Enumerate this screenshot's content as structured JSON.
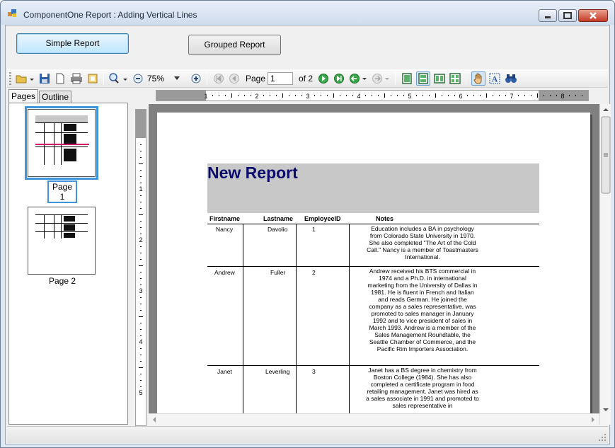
{
  "window": {
    "title": "ComponentOne Report : Adding Vertical Lines",
    "controls": [
      "minimize",
      "maximize",
      "close"
    ]
  },
  "buttons": {
    "simple_report": "Simple Report",
    "grouped_report": "Grouped Report"
  },
  "toolbar": {
    "zoom_value": "75%",
    "page_label": "Page",
    "page_value": "1",
    "of_label": "of 2"
  },
  "tabs": {
    "pages": "Pages",
    "outline": "Outline"
  },
  "thumbnails": [
    {
      "label": "Page 1",
      "selected": true
    },
    {
      "label": "Page 2",
      "selected": false
    }
  ],
  "rulers": {
    "horizontal_ticks": [
      "1",
      "2",
      "3",
      "4",
      "5",
      "6",
      "7",
      "8"
    ],
    "vertical_ticks": [
      "1",
      "2",
      "3",
      "4",
      "5"
    ]
  },
  "report": {
    "title": "New Report",
    "columns": [
      "Firstname",
      "Lastname",
      "EmployeeID",
      "Notes"
    ],
    "rows": [
      {
        "firstname": "Nancy",
        "lastname": "Davolio",
        "employee_id": "1",
        "notes": "Education includes a BA in psychology from Colorado State University in 1970.  She also completed \"The Art of the Cold Call.\"  Nancy is a member of Toastmasters International."
      },
      {
        "firstname": "Andrew",
        "lastname": "Fuller",
        "employee_id": "2",
        "notes": "Andrew received his BTS commercial in 1974 and a Ph.D. in international marketing from the University of Dallas in 1981.  He is fluent in French and Italian and reads German.  He joined the company as a sales representative, was promoted to sales manager in January 1992 and to vice president of sales in March 1993.  Andrew is a member of the Sales Management Roundtable, the Seattle Chamber of Commerce, and the Pacific Rim Importers Association."
      },
      {
        "firstname": "Janet",
        "lastname": "Leverling",
        "employee_id": "3",
        "notes": "Janet has a BS degree in chemistry from Boston College (1984).  She has also completed a certificate program in food retailing management.  Janet was hired as a sales associate in 1991 and promoted to sales representative in"
      }
    ]
  }
}
